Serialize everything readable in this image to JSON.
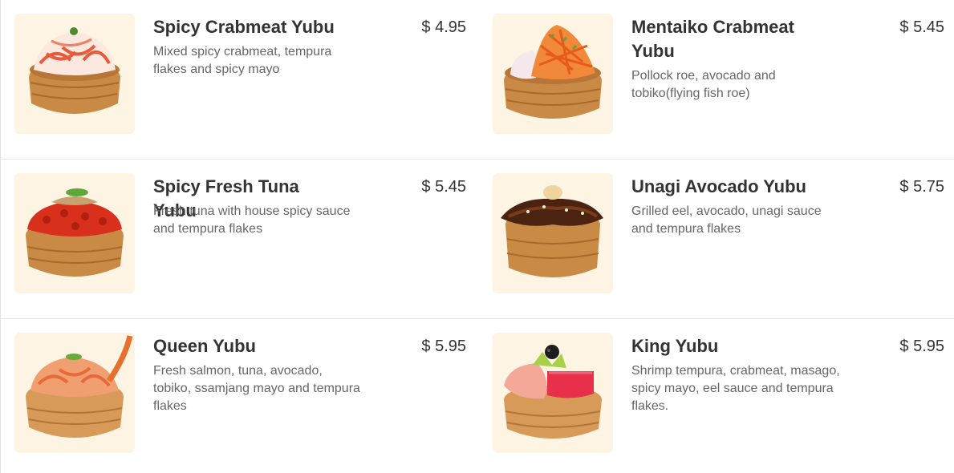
{
  "menu": {
    "items": [
      {
        "name": "Spicy Crabmeat Yubu",
        "price": "$ 4.95",
        "description": "Mixed spicy crabmeat, tempura flakes and spicy mayo",
        "icon": "crabmeat-yubu-photo"
      },
      {
        "name": "Mentaiko Crabmeat Yubu",
        "price": "$ 5.45",
        "description": "Pollock roe, avocado and tobiko(flying fish roe)",
        "icon": "mentaiko-yubu-photo"
      },
      {
        "name": "Spicy Fresh Tuna Yubu",
        "price": "$ 5.45",
        "description": "Fresh tuna with house spicy sauce and tempura flakes",
        "icon": "tuna-yubu-photo"
      },
      {
        "name": "Unagi Avocado Yubu",
        "price": "$ 5.75",
        "description": "Grilled eel, avocado, unagi sauce and tempura flakes",
        "icon": "unagi-yubu-photo"
      },
      {
        "name": "Queen Yubu",
        "price": "$ 5.95",
        "description": "Fresh salmon, tuna, avocado, tobiko, ssamjang mayo and tempura flakes",
        "icon": "queen-yubu-photo"
      },
      {
        "name": "King Yubu",
        "price": "$ 5.95",
        "description": "Shrimp tempura, crabmeat, masago, spicy mayo, eel sauce and tempura flakes.",
        "icon": "king-yubu-photo"
      }
    ]
  },
  "colors": {
    "thumb_bg": "#fdf4e3",
    "title": "#333333",
    "description": "#666666",
    "divider": "#e6e6e6",
    "tofu_pouch": "#c98a45"
  }
}
